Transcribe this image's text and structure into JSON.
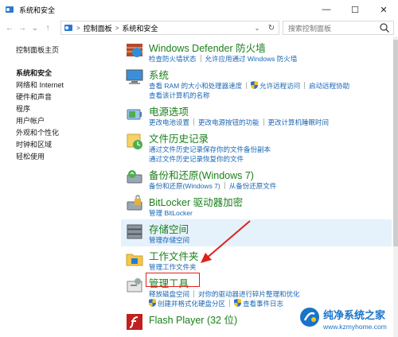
{
  "window": {
    "title": "系统和安全",
    "min": "—",
    "max": "☐",
    "close": "✕"
  },
  "nav": {
    "back": "←",
    "forward": "→",
    "dropdown": "⌄",
    "up": "↑"
  },
  "address": {
    "crumbs": [
      "控制面板",
      "系统和安全"
    ],
    "sep": ">",
    "dd": "⌄",
    "refresh": "↻"
  },
  "search": {
    "placeholder": "搜索控制面板"
  },
  "sidebar": {
    "home": "控制面板主页",
    "items": [
      {
        "label": "系统和安全",
        "active": true
      },
      {
        "label": "网络和 Internet"
      },
      {
        "label": "硬件和声音"
      },
      {
        "label": "程序"
      },
      {
        "label": "用户帐户"
      },
      {
        "label": "外观和个性化"
      },
      {
        "label": "时钟和区域"
      },
      {
        "label": "轻松使用"
      }
    ]
  },
  "categories": {
    "firewall": {
      "title": "Windows Defender 防火墙",
      "l1": "检查防火墙状态",
      "l2": "允许应用通过 Windows 防火墙"
    },
    "system": {
      "title": "系统",
      "l1": "查看 RAM 的大小和处理器速度",
      "l2": "允许远程访问",
      "l3": "启动远程协助",
      "l4": "查看该计算机的名称"
    },
    "power": {
      "title": "电源选项",
      "l1": "更改电池设置",
      "l2": "更改电源按钮的功能",
      "l3": "更改计算机睡眠时间"
    },
    "history": {
      "title": "文件历史记录",
      "l1": "通过文件历史记录保存你的文件备份副本",
      "l2": "通过文件历史记录恢复你的文件"
    },
    "backup": {
      "title": "备份和还原(Windows 7)",
      "l1": "备份和还原(Windows 7)",
      "l2": "从备份还原文件"
    },
    "bitlocker": {
      "title": "BitLocker 驱动器加密",
      "l1": "管理 BitLocker"
    },
    "storage": {
      "title": "存储空间",
      "l1": "管理存储空间"
    },
    "workfolders": {
      "title": "工作文件夹",
      "l1": "管理工作文件夹"
    },
    "admin": {
      "title": "管理工具",
      "l1": "释放磁盘空间",
      "l2": "对你的驱动器进行碎片整理和优化",
      "l3": "创建并格式化硬盘分区",
      "l4": "查看事件日志"
    },
    "flash": {
      "title": "Flash Player (32 位)"
    }
  },
  "watermark": {
    "name": "纯净系统之家",
    "url": "www.kzmyhome.com"
  },
  "colors": {
    "category_green": "#1a7f1a",
    "link_blue": "#1a66b3",
    "highlight": "#e5f1fb",
    "annotation_red": "#e0211b"
  }
}
